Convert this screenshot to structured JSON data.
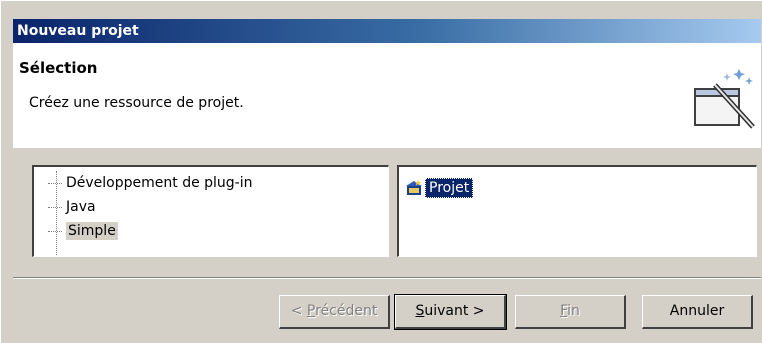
{
  "window": {
    "title": "Nouveau projet"
  },
  "header": {
    "title": "Sélection",
    "description": "Créez une ressource de projet.",
    "icon": "new-project-wizard-icon"
  },
  "categories": {
    "items": [
      {
        "label": "Développement de plug-in",
        "selected": false
      },
      {
        "label": "Java",
        "selected": false
      },
      {
        "label": "Simple",
        "selected": true
      }
    ]
  },
  "wizards": {
    "items": [
      {
        "label": "Projet",
        "icon": "project-folder-icon",
        "selected": true
      }
    ]
  },
  "buttons": {
    "prev": {
      "mnemonic": "P",
      "rest": "récédent",
      "prefix": "< ",
      "enabled": false
    },
    "next": {
      "mnemonic": "S",
      "rest": "uivant >",
      "enabled": true
    },
    "finish": {
      "mnemonic": "F",
      "rest": "in",
      "enabled": false
    },
    "cancel": {
      "label": "Annuler",
      "enabled": true
    }
  },
  "colors": {
    "title_bar_start": "#0a246a",
    "title_bar_end": "#a6caf0",
    "selection": "#0a246a",
    "dialog_bg": "#d4d0c8"
  }
}
